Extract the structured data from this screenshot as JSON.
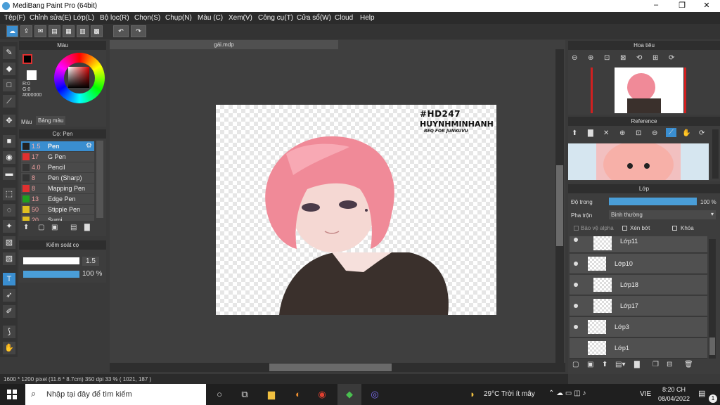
{
  "window": {
    "title": "MediBang Paint Pro (64bit)",
    "minimize": "–",
    "maximize": "❐",
    "close": "✕"
  },
  "menu": [
    "Tệp(F)",
    "Chỉnh sửa(E)",
    "Lớp(L)",
    "Bộ lọc(R)",
    "Chọn(S)",
    "Chụp(N)",
    "Màu (C)",
    "Xem(V)",
    "Công cụ(T)",
    "Cửa sổ(W)",
    "Cloud",
    "Help"
  ],
  "color_panel": {
    "title": "Màu",
    "r": "R:0",
    "g": "G:0",
    "b": "B:0",
    "hex": "#000000",
    "tab_color": "Màu",
    "tab_palette": "Bảng màu"
  },
  "brush_panel": {
    "title": "Cọ: Pen",
    "items": [
      {
        "size": "1.5",
        "name": "Pen",
        "color": "#222222"
      },
      {
        "size": "17",
        "name": "G Pen",
        "color": "#e03030"
      },
      {
        "size": "4.0",
        "name": "Pencil",
        "color": "#333333"
      },
      {
        "size": "8",
        "name": "Pen (Sharp)",
        "color": "#333333"
      },
      {
        "size": "8",
        "name": "Mapping Pen",
        "color": "#e03030"
      },
      {
        "size": "13",
        "name": "Edge Pen",
        "color": "#20a020"
      },
      {
        "size": "50",
        "name": "Stipple Pen",
        "color": "#e0c020"
      },
      {
        "size": "20",
        "name": "Sumi",
        "color": "#e0c020"
      }
    ]
  },
  "brush_control": {
    "title": "Kiểm soát cọ",
    "size": "1.5",
    "opacity": "100 %",
    "opacity_fraction": 1.0
  },
  "document": {
    "tab": "gái.mdp",
    "artwork_line1": "#HD247",
    "artwork_line2": "HUYNHMINHANH",
    "artwork_line3": "REQ FOR JUNKUVU"
  },
  "navigator": {
    "title": "Hoa tiêu"
  },
  "reference": {
    "title": "Reference"
  },
  "layers": {
    "title": "Lớp",
    "opacity_label": "Độ trong",
    "opacity": "100 %",
    "opacity_fraction": 1.0,
    "blend_label": "Pha trộn",
    "blend_value": "Bình thường",
    "protect_alpha": "Bảo vệ alpha",
    "clipping": "Xén bớt",
    "lock": "Khóa",
    "items": [
      {
        "name": "Lớp11",
        "indent": true
      },
      {
        "name": "Lớp10",
        "indent": false
      },
      {
        "name": "Lớp18",
        "indent": true
      },
      {
        "name": "Lớp17",
        "indent": true
      },
      {
        "name": "Lớp3",
        "indent": false
      },
      {
        "name": "Lớp1",
        "indent": false
      }
    ]
  },
  "status": {
    "text": "1600 * 1200 pixel   (11.6 * 8.7cm)   350 dpi   33 %   ( 1021, 187 )"
  },
  "taskbar": {
    "search_placeholder": "Nhập tại đây để tìm kiếm",
    "weather": "29°C  Trời ít mây",
    "lang": "VIE",
    "time": "8:20 CH",
    "date": "08/04/2022",
    "notif_count": "1"
  },
  "colors": {
    "accent": "#4a9ed8",
    "selected": "#3a8ed0"
  }
}
